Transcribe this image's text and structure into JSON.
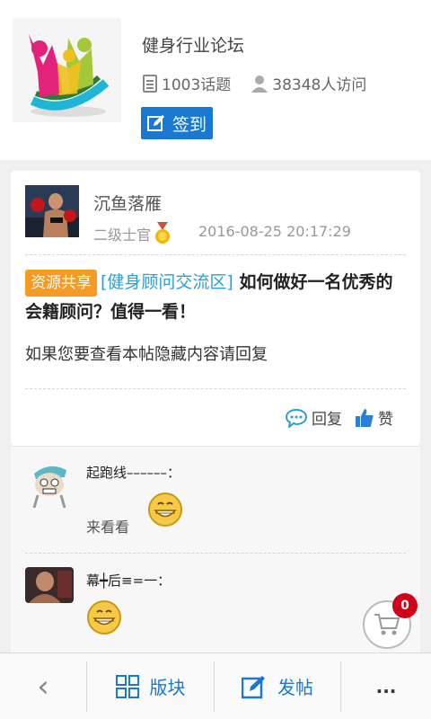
{
  "forum": {
    "title": "健身行业论坛",
    "topics": "1003话题",
    "visitors": "38348人访问",
    "checkin_label": "签到"
  },
  "post": {
    "author": "沉鱼落雁",
    "rank": "二级士官",
    "time": "2016-08-25 20:17:29",
    "tag": "资源共享",
    "category": "[健身顾问交流区]",
    "title": "如何做好一名优秀的会籍顾问？值得一看！",
    "hidden_notice": "如果您要查看本帖隐藏内容请回复",
    "reply_label": "回复",
    "like_label": "赞"
  },
  "replies": [
    {
      "author": "起跑线––––––：",
      "text": "来看看",
      "emoji": "grin-emoji"
    },
    {
      "author": "幕┿后≡=一：",
      "text": "",
      "emoji": "grin-emoji"
    }
  ],
  "cart": {
    "count": "0"
  },
  "bottom_nav": {
    "back_label": "‹",
    "sections_label": "版块",
    "post_label": "发帖",
    "more_label": "..."
  },
  "colors": {
    "accent": "#1a78d0",
    "tag": "#f59a23",
    "badge": "#d0021b",
    "link": "#2a9fd6"
  }
}
